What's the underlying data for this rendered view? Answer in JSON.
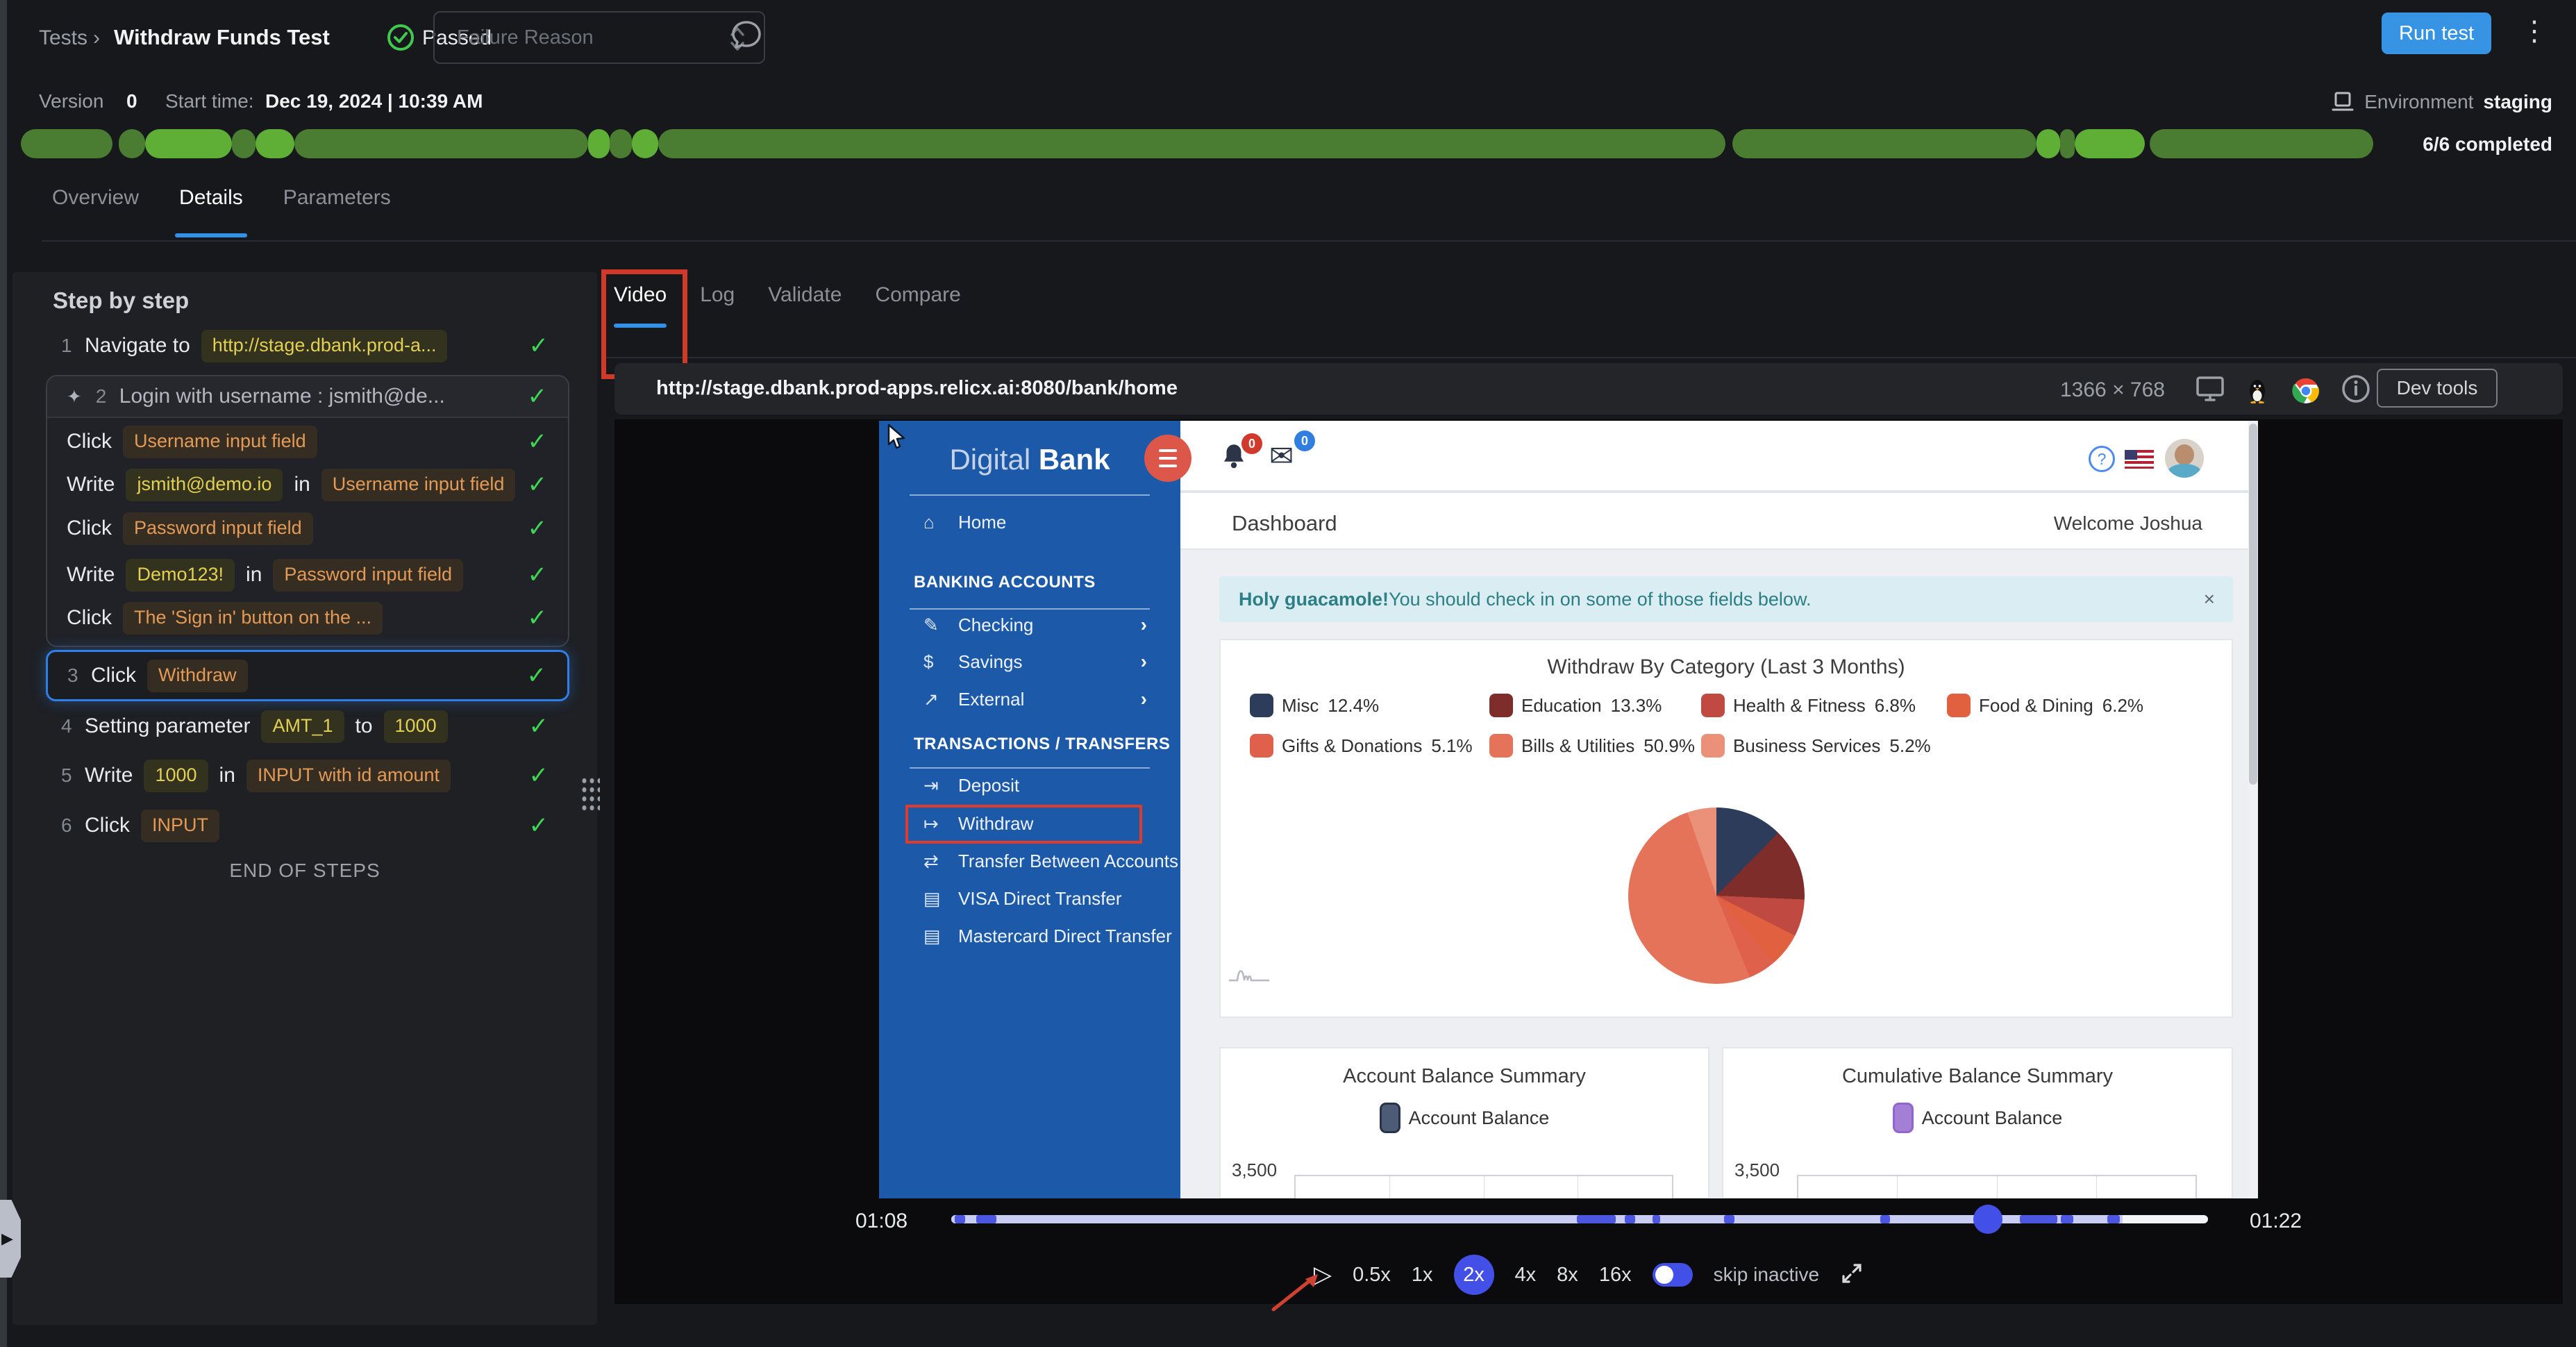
{
  "header": {
    "breadcrumb_root": "Tests",
    "breadcrumb_sep": "›",
    "title": "Withdraw Funds Test",
    "status": "Passed",
    "failure_reason_placeholder": "Failure Reason",
    "run_test_label": "Run test"
  },
  "meta": {
    "version_label": "Version",
    "version_value": "0",
    "start_time_label": "Start time:",
    "start_time_value": "Dec 19, 2024 | 10:39 AM",
    "environment_label": "Environment",
    "environment_value": "staging",
    "completed_label": "6/6 completed"
  },
  "progress_segments": [
    {
      "w": 3.8,
      "color": "#4a7c31",
      "gap": 0
    },
    {
      "w": 1.1,
      "color": "#4a7c31",
      "gap": 0.25
    },
    {
      "w": 3.6,
      "color": "#5fae36",
      "gap": 0
    },
    {
      "w": 1.0,
      "color": "#4a7c31",
      "gap": 0
    },
    {
      "w": 1.6,
      "color": "#5fae36",
      "gap": 0
    },
    {
      "w": 12.2,
      "color": "#4a7c31",
      "gap": 0
    },
    {
      "w": 0.9,
      "color": "#5fae36",
      "gap": 0
    },
    {
      "w": 0.9,
      "color": "#4a7c31",
      "gap": 0
    },
    {
      "w": 1.1,
      "color": "#5fae36",
      "gap": 0
    },
    {
      "w": 44.3,
      "color": "#4a7c31",
      "gap": 0
    },
    {
      "w": 12.6,
      "color": "#4a7c31",
      "gap": 0.3
    },
    {
      "w": 1.0,
      "color": "#5fae36",
      "gap": 0
    },
    {
      "w": 0.6,
      "color": "#4a7c31",
      "gap": 0
    },
    {
      "w": 2.9,
      "color": "#5fae36",
      "gap": 0
    },
    {
      "w": 9.3,
      "color": "#4a7c31",
      "gap": 0.2
    }
  ],
  "page_tabs": [
    {
      "label": "Overview",
      "active": false
    },
    {
      "label": "Details",
      "active": true
    },
    {
      "label": "Parameters",
      "active": false
    }
  ],
  "steps_panel": {
    "title": "Step by step",
    "end_label": "END OF STEPS",
    "steps": [
      {
        "kind": "row",
        "num": "1",
        "tokens": [
          {
            "t": "text",
            "v": "Navigate to"
          },
          {
            "t": "value",
            "v": "http://stage.dbank.prod-a..."
          }
        ]
      },
      {
        "kind": "group",
        "num": "2",
        "icon": "sparkle-icon",
        "header": "Login with username : jsmith@de...",
        "children": [
          {
            "tokens": [
              {
                "t": "text",
                "v": "Click"
              },
              {
                "t": "elem",
                "v": "Username input field"
              }
            ]
          },
          {
            "tokens": [
              {
                "t": "text",
                "v": "Write"
              },
              {
                "t": "value",
                "v": "jsmith@demo.io"
              },
              {
                "t": "text",
                "v": "in"
              },
              {
                "t": "elem",
                "v": "Username input field"
              }
            ]
          },
          {
            "tokens": [
              {
                "t": "text",
                "v": "Click"
              },
              {
                "t": "elem",
                "v": "Password input field"
              }
            ]
          },
          {
            "tokens": [
              {
                "t": "text",
                "v": "Write"
              },
              {
                "t": "value",
                "v": "Demo123!"
              },
              {
                "t": "text",
                "v": "in"
              },
              {
                "t": "elem",
                "v": "Password input field"
              }
            ]
          },
          {
            "tokens": [
              {
                "t": "text",
                "v": "Click"
              },
              {
                "t": "elem",
                "v": "The 'Sign in' button on the ..."
              }
            ]
          }
        ]
      },
      {
        "kind": "row",
        "num": "3",
        "selected": true,
        "tokens": [
          {
            "t": "text",
            "v": "Click"
          },
          {
            "t": "elem",
            "v": "Withdraw"
          }
        ]
      },
      {
        "kind": "row",
        "num": "4",
        "tokens": [
          {
            "t": "text",
            "v": "Setting parameter"
          },
          {
            "t": "value",
            "v": "AMT_1"
          },
          {
            "t": "text",
            "v": "to"
          },
          {
            "t": "value",
            "v": "1000"
          }
        ]
      },
      {
        "kind": "row",
        "num": "5",
        "tokens": [
          {
            "t": "text",
            "v": "Write"
          },
          {
            "t": "value",
            "v": "1000"
          },
          {
            "t": "text",
            "v": "in"
          },
          {
            "t": "elem",
            "v": "INPUT with id amount"
          }
        ]
      },
      {
        "kind": "row",
        "num": "6",
        "tokens": [
          {
            "t": "text",
            "v": "Click"
          },
          {
            "t": "elem",
            "v": "INPUT"
          }
        ]
      }
    ]
  },
  "viewer": {
    "tabs": [
      {
        "label": "Video",
        "active": true
      },
      {
        "label": "Log",
        "active": false
      },
      {
        "label": "Validate",
        "active": false
      },
      {
        "label": "Compare",
        "active": false
      }
    ],
    "url": "http://stage.dbank.prod-apps.relicx.ai:8080/bank/home",
    "resolution": "1366 × 768",
    "icons": [
      "display-icon",
      "linux-icon",
      "chrome-icon",
      "info-icon"
    ],
    "devtools_label": "Dev tools",
    "time_current": "01:08",
    "time_total": "01:22",
    "playhead_pct": 82.5,
    "played_pct": 93.2,
    "markers": [
      {
        "s": 0.3,
        "w": 0.8
      },
      {
        "s": 2.0,
        "w": 1.6
      },
      {
        "s": 49.8,
        "w": 3.1
      },
      {
        "s": 53.6,
        "w": 0.8
      },
      {
        "s": 55.8,
        "w": 0.6
      },
      {
        "s": 61.5,
        "w": 0.8
      },
      {
        "s": 73.9,
        "w": 0.8
      },
      {
        "s": 85.0,
        "w": 3.0
      },
      {
        "s": 88.3,
        "w": 1.0
      },
      {
        "s": 92.0,
        "w": 1.0
      }
    ],
    "speeds": [
      "0.5x",
      "1x",
      "2x",
      "4x",
      "8x",
      "16x"
    ],
    "active_speed": "2x",
    "skip_inactive_label": "skip inactive"
  },
  "bank_app": {
    "logo_light": "Digital",
    "logo_bold": "Bank",
    "home_label": "Home",
    "bell_badge": "0",
    "mail_badge": "0",
    "help_glyph": "?",
    "nav_sections": [
      {
        "title": "BANKING ACCOUNTS",
        "items": [
          {
            "icon": "edit-icon",
            "label": "Checking",
            "chevron": "›"
          },
          {
            "icon": "money-icon",
            "label": "Savings",
            "chevron": "›"
          },
          {
            "icon": "external-link-icon",
            "label": "External",
            "chevron": "›"
          }
        ]
      },
      {
        "title": "TRANSACTIONS / TRANSFERS",
        "items": [
          {
            "icon": "deposit-icon",
            "label": "Deposit"
          },
          {
            "icon": "withdraw-icon",
            "label": "Withdraw",
            "annotated": true
          },
          {
            "icon": "transfer-icon",
            "label": "Transfer Between Accounts"
          },
          {
            "icon": "card-icon",
            "label": "VISA Direct Transfer"
          },
          {
            "icon": "card-icon",
            "label": "Mastercard Direct Transfer"
          }
        ]
      }
    ],
    "page_title": "Dashboard",
    "welcome": "Welcome Joshua",
    "alert_bold": "Holy guacamole!",
    "alert_rest": " You should check in on some of those fields below.",
    "alert_close": "×"
  },
  "chart_data": [
    {
      "type": "pie",
      "title": "Withdraw By Category (Last 3 Months)",
      "labels": [
        "Misc",
        "Education",
        "Health & Fitness",
        "Food & Dining",
        "Gifts & Donations",
        "Bills & Utilities",
        "Business Services"
      ],
      "values": [
        12.4,
        13.3,
        6.8,
        6.2,
        5.1,
        50.9,
        5.2
      ],
      "colors": [
        "#2c3c5a",
        "#7e2d2b",
        "#c04a42",
        "#e0603f",
        "#e0614b",
        "#e4735a",
        "#eb917a"
      ],
      "legend_position": "top"
    },
    {
      "type": "bar",
      "title": "Account Balance Summary",
      "series": [
        {
          "name": "Account Balance",
          "color": "#4d5b76",
          "border": "#263349"
        }
      ],
      "yticks": [
        "3,500"
      ]
    },
    {
      "type": "bar",
      "title": "Cumulative Balance Summary",
      "series": [
        {
          "name": "Account Balance",
          "color": "#a37fd6",
          "border": "#9265cc"
        }
      ],
      "yticks": [
        "3,500"
      ]
    }
  ]
}
